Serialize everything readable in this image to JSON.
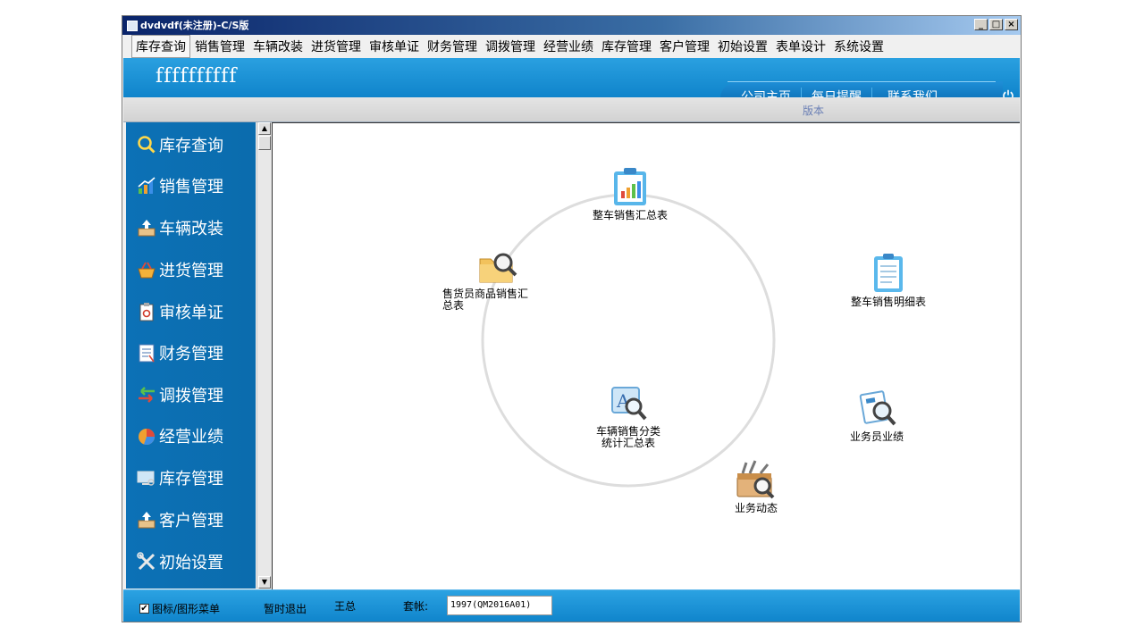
{
  "window": {
    "title": "dvdvdf(未注册)-C/S版",
    "controls": [
      "_",
      "□",
      "×"
    ]
  },
  "menu": [
    "库存查询",
    "销售管理",
    "车辆改装",
    "进货管理",
    "审核单证",
    "财务管理",
    "调拨管理",
    "经营业绩",
    "库存管理",
    "客户管理",
    "初始设置",
    "表单设计",
    "系统设置"
  ],
  "header": {
    "company": "ffffffffff",
    "nav": [
      "公司主页",
      "每日提醒",
      "联系我们"
    ],
    "version": "版本"
  },
  "sidebar": [
    {
      "label": "库存查询",
      "icon": "search-icon"
    },
    {
      "label": "销售管理",
      "icon": "chart-icon"
    },
    {
      "label": "车辆改装",
      "icon": "box-upload-icon"
    },
    {
      "label": "进货管理",
      "icon": "basket-icon"
    },
    {
      "label": "审核单证",
      "icon": "clipboard-search-icon"
    },
    {
      "label": "财务管理",
      "icon": "notepad-icon"
    },
    {
      "label": "调拨管理",
      "icon": "transfer-arrows-icon"
    },
    {
      "label": "经营业绩",
      "icon": "pie-chart-icon"
    },
    {
      "label": "库存管理",
      "icon": "monitor-icon"
    },
    {
      "label": "客户管理",
      "icon": "box-upload-icon"
    },
    {
      "label": "初始设置",
      "icon": "tools-icon"
    }
  ],
  "flow": [
    {
      "label": "整车销售汇总表",
      "icon": "clipboard-chart-icon"
    },
    {
      "label": "整车销售明细表",
      "icon": "notepad-icon"
    },
    {
      "label": "业务员业绩",
      "icon": "document-search-icon"
    },
    {
      "label": "业务动态",
      "icon": "toolbox-search-icon"
    },
    {
      "label": "车辆销售分类\n统计汇总表",
      "icon": "text-search-icon"
    },
    {
      "label": "售货员商品销售汇\n总表",
      "icon": "folder-search-icon"
    }
  ],
  "status": {
    "toggle_label": "图标/图形菜单",
    "toggle_checked": true,
    "exit_label": "暂时退出",
    "user": "王总",
    "account_label": "套帐:",
    "account_value": "1997(QM2016A01)"
  },
  "colors": {
    "accent": "#0f84cb",
    "sidebar": "#0c71b6"
  }
}
